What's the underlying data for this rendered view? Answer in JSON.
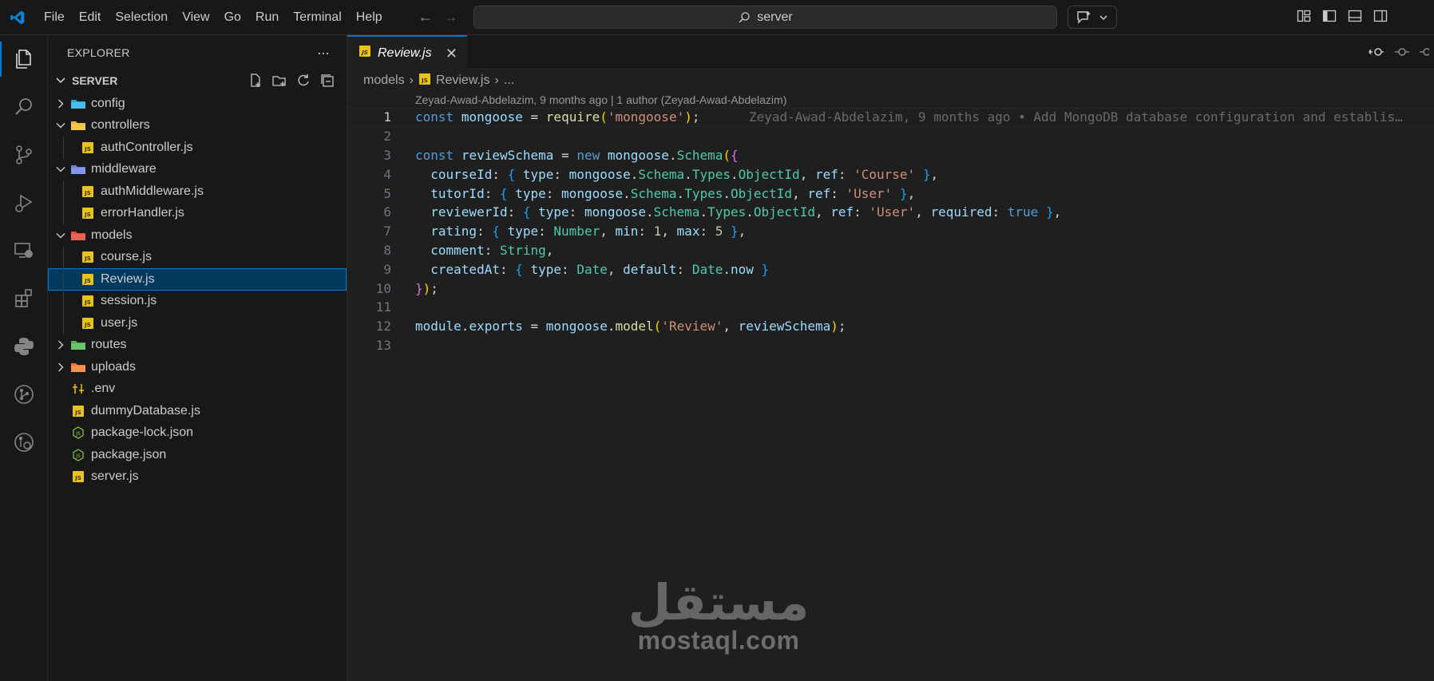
{
  "menu": [
    "File",
    "Edit",
    "Selection",
    "View",
    "Go",
    "Run",
    "Terminal",
    "Help"
  ],
  "search": {
    "value": "server"
  },
  "sidebar": {
    "title": "EXPLORER",
    "more": "···",
    "section": "SERVER",
    "items": [
      {
        "label": "config",
        "type": "folder",
        "expanded": false,
        "depth": 0,
        "icon": "config-folder-icon"
      },
      {
        "label": "controllers",
        "type": "folder",
        "expanded": true,
        "depth": 0,
        "icon": "controllers-folder-icon"
      },
      {
        "label": "authController.js",
        "type": "js",
        "depth": 1
      },
      {
        "label": "middleware",
        "type": "folder",
        "expanded": true,
        "depth": 0,
        "icon": "middleware-folder-icon"
      },
      {
        "label": "authMiddleware.js",
        "type": "js",
        "depth": 1
      },
      {
        "label": "errorHandler.js",
        "type": "js",
        "depth": 1
      },
      {
        "label": "models",
        "type": "folder",
        "expanded": true,
        "depth": 0,
        "icon": "models-folder-icon"
      },
      {
        "label": "course.js",
        "type": "js",
        "depth": 1
      },
      {
        "label": "Review.js",
        "type": "js",
        "depth": 1,
        "selected": true
      },
      {
        "label": "session.js",
        "type": "js",
        "depth": 1
      },
      {
        "label": "user.js",
        "type": "js",
        "depth": 1
      },
      {
        "label": "routes",
        "type": "folder",
        "expanded": false,
        "depth": 0,
        "icon": "routes-folder-icon"
      },
      {
        "label": "uploads",
        "type": "folder",
        "expanded": false,
        "depth": 0,
        "icon": "uploads-folder-icon"
      },
      {
        "label": ".env",
        "type": "env",
        "depth": 0
      },
      {
        "label": "dummyDatabase.js",
        "type": "js",
        "depth": 0
      },
      {
        "label": "package-lock.json",
        "type": "json",
        "depth": 0
      },
      {
        "label": "package.json",
        "type": "json",
        "depth": 0
      },
      {
        "label": "server.js",
        "type": "js",
        "depth": 0
      }
    ]
  },
  "editor": {
    "tab": "Review.js",
    "tab_close": "✕",
    "breadcrumb": {
      "folder": "models",
      "file": "Review.js",
      "more": "..."
    },
    "codelens": "Zeyad-Awad-Abdelazim, 9 months ago | 1 author (Zeyad-Awad-Abdelazim)",
    "blame": "Zeyad-Awad-Abdelazim, 9 months ago • Add MongoDB database configuration and establis…",
    "line_numbers": [
      "1",
      "2",
      "3",
      "4",
      "5",
      "6",
      "7",
      "8",
      "9",
      "10",
      "11",
      "12",
      "13"
    ]
  },
  "watermark": {
    "arabic": "مستقل",
    "latin": "mostaql.com"
  },
  "colors": {
    "accent": "#0078d4",
    "selection": "#04395e",
    "js_icon": "#f1c40f"
  }
}
